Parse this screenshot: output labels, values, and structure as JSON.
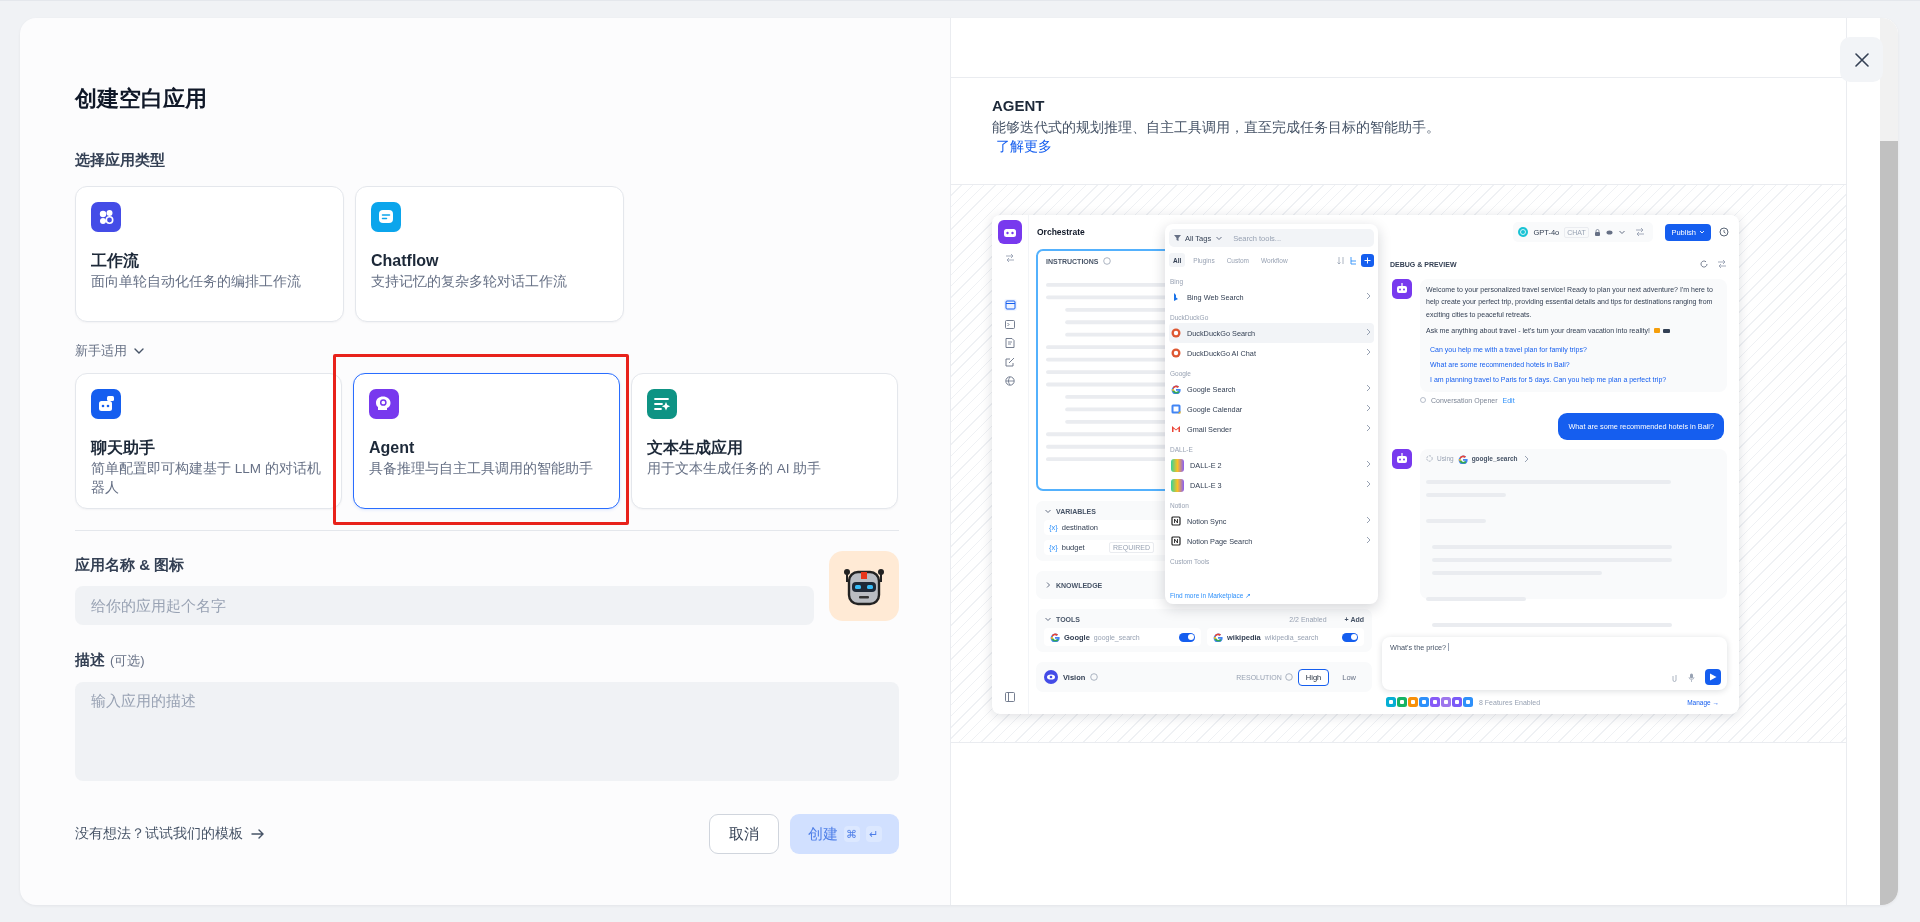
{
  "dialog": {
    "title": "创建空白应用"
  },
  "type_section": {
    "label": "选择应用类型"
  },
  "app_types": [
    {
      "kind": "workflow",
      "title": "工作流",
      "description": "面向单轮自动化任务的编排工作流",
      "selected": false,
      "highlighted": false
    },
    {
      "kind": "chatflow",
      "title": "Chatflow",
      "description": "支持记忆的复杂多轮对话工作流",
      "selected": false,
      "highlighted": false
    }
  ],
  "beginner_section": {
    "label": "新手适用",
    "expanded": true
  },
  "beginner_types": [
    {
      "kind": "chatbot",
      "title": "聊天助手",
      "description": "简单配置即可构建基于 LLM 的对话机器人",
      "selected": false,
      "highlighted": false
    },
    {
      "kind": "agent",
      "title": "Agent",
      "description": "具备推理与自主工具调用的智能助手",
      "selected": true,
      "highlighted": true
    },
    {
      "kind": "completion",
      "title": "文本生成应用",
      "description": "用于文本生成任务的 AI 助手",
      "selected": false,
      "highlighted": false
    }
  ],
  "name_field": {
    "label": "应用名称 & 图标",
    "placeholder": "给你的应用起个名字"
  },
  "description_field": {
    "label": "描述",
    "hint": "(可选)",
    "placeholder": "输入应用的描述"
  },
  "template_link": "没有想法？试试我们的模板",
  "buttons": [
    {
      "kind": "cancel",
      "label": "取消",
      "disabled": false
    },
    {
      "kind": "create",
      "label": "创建",
      "disabled": true,
      "keys": [
        "⌘",
        "↵"
      ]
    }
  ],
  "info": {
    "title": "AGENT",
    "description": "能够迭代式的规划推理、自主工具调用，直至完成任务目标的智能助手。",
    "link": "了解更多"
  },
  "preview": {
    "title": "Orchestrate",
    "instructions": {
      "label": "INSTRUCTIONS"
    },
    "variables": {
      "label": "VARIABLES",
      "expanded": true,
      "items": [
        {
          "prefix": "{x}",
          "name": "destination"
        },
        {
          "prefix": "{x}",
          "name": "budget",
          "badge": "REQUIRED"
        }
      ]
    },
    "knowledge": {
      "label": "KNOWLEDGE",
      "expanded": false
    },
    "tools": {
      "label": "TOOLS",
      "expanded": true,
      "count": "2/2 Enabled",
      "add": "+ Add",
      "items": [
        {
          "name": "Google",
          "tool_id": "google_search",
          "on": true
        },
        {
          "name": "wikipedia",
          "tool_id": "wikipedia_search",
          "on": true
        }
      ]
    },
    "vision": {
      "label": "Vision",
      "resolution_label": "RESOLUTION",
      "options": [
        {
          "label": "High",
          "selected": true
        },
        {
          "label": "Low",
          "selected": false
        }
      ]
    },
    "tool_picker": {
      "filter": "All Tags",
      "search_placeholder": "Search tools...",
      "tabs": [
        {
          "label": "All",
          "selected": true
        },
        {
          "label": "Plugins",
          "selected": false
        },
        {
          "label": "Custom",
          "selected": false
        },
        {
          "label": "Workflow",
          "selected": false
        }
      ],
      "groups": [
        {
          "label": "Bing",
          "items": [
            {
              "name": "Bing Web Search",
              "selected": false
            }
          ]
        },
        {
          "label": "DuckDuckGo",
          "items": [
            {
              "name": "DuckDuckGo Search",
              "selected": true
            },
            {
              "name": "DuckDuckGo AI Chat",
              "selected": false
            }
          ]
        },
        {
          "label": "Google",
          "items": [
            {
              "name": "Google Search",
              "selected": false
            },
            {
              "name": "Google Calendar",
              "selected": false
            },
            {
              "name": "Gmail Sender",
              "selected": false
            }
          ]
        },
        {
          "label": "DALL-E",
          "items": [
            {
              "name": "DALL-E 2",
              "selected": false
            },
            {
              "name": "DALL-E 3",
              "selected": false
            }
          ]
        },
        {
          "label": "Notion",
          "items": [
            {
              "name": "Notion Sync",
              "selected": false
            },
            {
              "name": "Notion Page Search",
              "selected": false
            }
          ]
        },
        {
          "label": "Custom Tools"
        }
      ],
      "footer": "Find more in Marketplace ↗"
    },
    "model": {
      "name": "GPT-4o",
      "badge": "CHAT"
    },
    "publish": "Publish",
    "debug": {
      "title": "DEBUG & PREVIEW",
      "messages": [
        {
          "kind": "bot",
          "paragraphs": [
            "Welcome to your personalized travel service! Ready to plan your next adventure? I'm here to help create your perfect trip, providing essential details and tips for destinations ranging from exciting cities to peaceful retreats.",
            "Ask me anything about travel - let's turn your dream vacation into reality!"
          ],
          "suggestions": [
            "Can you help me with a travel plan for family trips?",
            "What are some recommended hotels in Bali?",
            "I am planning travel to Paris for 5 days. Can you help me plan a perfect trip?"
          ],
          "opener": "Conversation Opener",
          "edit": "Edit"
        },
        {
          "kind": "user",
          "text": "What are some recommended hotels in Bali?"
        },
        {
          "kind": "tool",
          "using": "Using",
          "tool": "google_search"
        }
      ],
      "input": "What's the price?",
      "features": "8 Features Enabled",
      "manage": "Manage →"
    }
  }
}
